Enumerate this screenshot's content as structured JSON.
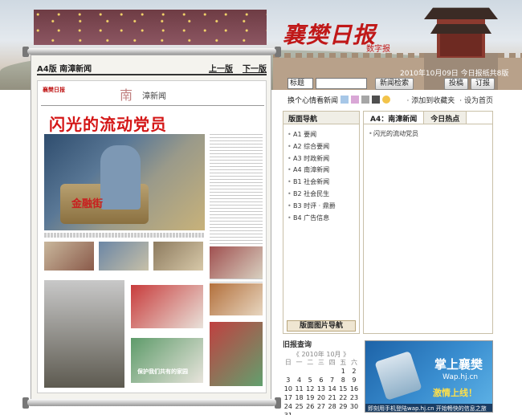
{
  "header": {
    "logo": "襄樊日报",
    "logo_sub": "数字报",
    "date_line": "2010年10月09日 今日报纸共8版"
  },
  "search": {
    "field_select": "标题",
    "query": "",
    "search_button": "新闻检索",
    "submit_button": "投稿",
    "subscribe_button": "订报"
  },
  "toolbar": {
    "mood_label": "换个心情看新闻",
    "swatches": [
      "#a7c7e7",
      "#d9a7d6",
      "#a6a6a6",
      "#4f4f4f"
    ],
    "favorite_link": "· 添加到收藏夹",
    "homepage_link": "· 设为首页"
  },
  "page_bar": {
    "title": "A4版  南漳新闻",
    "prev": "上一版",
    "next": "下一版"
  },
  "paper": {
    "masthead": "襄樊日报",
    "section_big": "南",
    "section_small": "漳新闻",
    "headline": "闪光的流动党员",
    "tank_text": "金融街",
    "home_text": "保护我们共有的家园"
  },
  "nav_panel": {
    "title": "版面导航",
    "items": [
      "A1  要闻",
      "A2  综合要闻",
      "A3  时政新闻",
      "A4  南漳新闻",
      "B1  社会新闻",
      "B2  社会民生",
      "B3  时评 · 鼎爵",
      "B4  广告信息"
    ],
    "pic_nav_button": "版面图片导航"
  },
  "article_panel": {
    "tab_current": "A4：南漳新闻",
    "tab_hot": "今日热点",
    "items": [
      "闪光的流动党员"
    ]
  },
  "calendar": {
    "title": "旧报查询",
    "nav": "《 2010年 10月 》",
    "weekdays": [
      "日",
      "一",
      "二",
      "三",
      "四",
      "五",
      "六"
    ],
    "rows": [
      [
        "",
        "",
        "",
        "",
        "",
        "1",
        "2"
      ],
      [
        "3",
        "4",
        "5",
        "6",
        "7",
        "8",
        "9"
      ],
      [
        "10",
        "11",
        "12",
        "13",
        "14",
        "15",
        "16"
      ],
      [
        "17",
        "18",
        "19",
        "20",
        "21",
        "22",
        "23"
      ],
      [
        "24",
        "25",
        "26",
        "27",
        "28",
        "29",
        "30"
      ],
      [
        "31",
        "",
        "",
        "",
        "",
        "",
        ""
      ]
    ]
  },
  "ad": {
    "title": "掌上襄樊",
    "url": "Wap.hj.cn",
    "slogan": "激情上线！",
    "footer": "即刻用手机登陆wap.hj.cn  开始畅快的信息之旅"
  }
}
